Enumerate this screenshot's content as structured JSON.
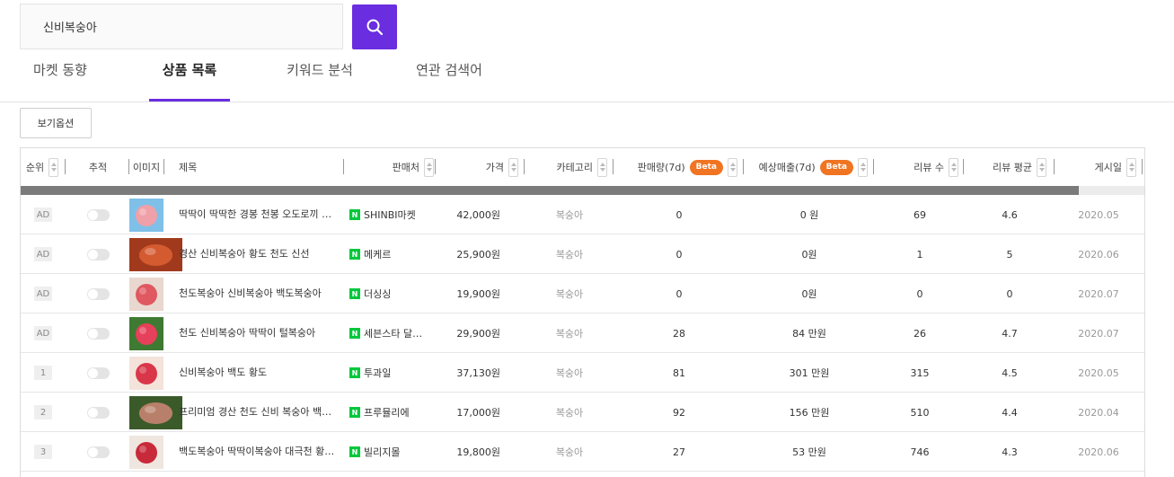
{
  "search": {
    "value": "신비복숭아"
  },
  "tabs": [
    {
      "label": "마켓 동향"
    },
    {
      "label": "상품 목록"
    },
    {
      "label": "키워드 분석"
    },
    {
      "label": "연관 검색어"
    }
  ],
  "view_options_label": "보기옵션",
  "beta_label": "Beta",
  "table": {
    "headers": {
      "rank": "순위",
      "track": "추적",
      "image": "이미지",
      "title": "제목",
      "seller": "판매처",
      "price": "가격",
      "category": "카테고리",
      "sales": "판매량(7d)",
      "revenue": "예상매출(7d)",
      "reviews": "리뷰 수",
      "rating": "리뷰 평균",
      "date": "게시일"
    },
    "loading_progress": 0.94,
    "rows": [
      {
        "rank": "AD",
        "title": "딱딱이 딱딱한 경봉 천봉 오도로끼 …",
        "seller": "SHINBI마켓",
        "price": "42,000원",
        "category": "복숭아",
        "sales": "0",
        "revenue": "0 원",
        "reviews": "69",
        "rating": "4.6",
        "date": "2020.05"
      },
      {
        "rank": "AD",
        "title": "경산 신비복숭아 황도 천도 신선",
        "seller": "메케르",
        "price": "25,900원",
        "category": "복숭아",
        "sales": "0",
        "revenue": "0원",
        "reviews": "1",
        "rating": "5",
        "date": "2020.06"
      },
      {
        "rank": "AD",
        "title": "천도복숭아 신비복숭아 백도복숭아",
        "seller": "더싱싱",
        "price": "19,900원",
        "category": "복숭아",
        "sales": "0",
        "revenue": "0원",
        "reviews": "0",
        "rating": "0",
        "date": "2020.07"
      },
      {
        "rank": "AD",
        "title": "천도 신비복숭아 딱딱이 털복숭아",
        "seller": "세븐스타 달…",
        "price": "29,900원",
        "category": "복숭아",
        "sales": "28",
        "revenue": "84 만원",
        "reviews": "26",
        "rating": "4.7",
        "date": "2020.07"
      },
      {
        "rank": "1",
        "title": "신비복숭아 백도 황도",
        "seller": "투과일",
        "price": "37,130원",
        "category": "복숭아",
        "sales": "81",
        "revenue": "301 만원",
        "reviews": "315",
        "rating": "4.5",
        "date": "2020.05"
      },
      {
        "rank": "2",
        "title": "프리미엄 경산 천도 신비 복숭아 백…",
        "seller": "프루뮬리에",
        "price": "17,000원",
        "category": "복숭아",
        "sales": "92",
        "revenue": "156 만원",
        "reviews": "510",
        "rating": "4.4",
        "date": "2020.04"
      },
      {
        "rank": "3",
        "title": "백도복숭아 딱딱이복숭아 대극천 황…",
        "seller": "빌리지몰",
        "price": "19,800원",
        "category": "복숭아",
        "sales": "27",
        "revenue": "53 만원",
        "reviews": "746",
        "rating": "4.3",
        "date": "2020.06"
      }
    ]
  }
}
